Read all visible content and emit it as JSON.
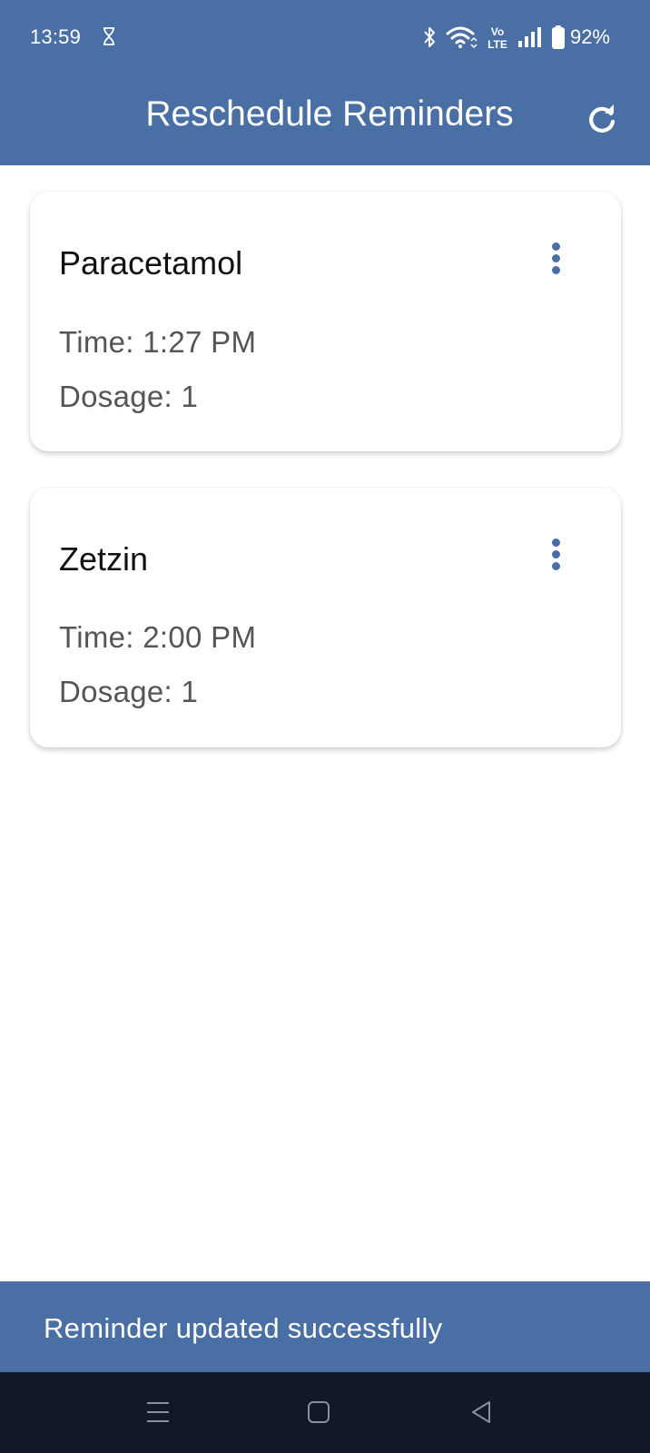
{
  "status_bar": {
    "time": "13:59",
    "battery": "92%",
    "icons": [
      "hourglass-icon",
      "bluetooth-icon",
      "wifi-icon",
      "volte-icon",
      "signal-icon",
      "battery-icon"
    ],
    "volte_top": "Vo",
    "volte_bottom": "LTE"
  },
  "app_bar": {
    "title": "Reschedule Reminders",
    "action_icon": "refresh-icon"
  },
  "reminders": [
    {
      "name": "Paracetamol",
      "time": "Time: 1:27 PM",
      "dosage": "Dosage: 1"
    },
    {
      "name": "Zetzin",
      "time": "Time: 2:00 PM",
      "dosage": "Dosage: 1"
    }
  ],
  "snackbar": {
    "message": "Reminder updated successfully"
  },
  "nav_bar": {
    "icons": [
      "recents-icon",
      "home-icon",
      "back-icon"
    ]
  },
  "colors": {
    "primary": "#4a6fa5",
    "nav_background": "#111827",
    "card_background": "#ffffff",
    "secondary_text": "#555555"
  }
}
